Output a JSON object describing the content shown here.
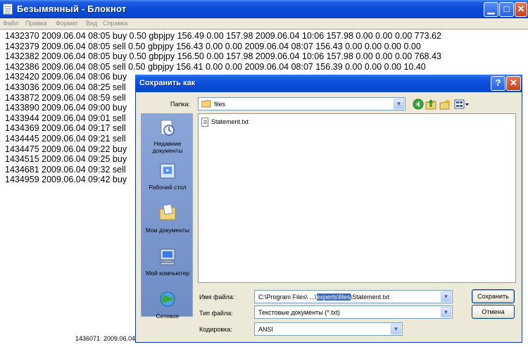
{
  "notepad": {
    "title": "Безымянный - Блокнот",
    "menu": [
      "Файл",
      "Правка",
      "Формат",
      "Вид",
      "Справка"
    ],
    "lines": [
      "1432370 2009.06.04 08:05 buy 0.50 gbpjpy 156.49 0.00 157.98 2009.06.04 10:06 157.98 0.00 0.00 0.00 773.62",
      "1432379 2009.06.04 08:05 sell 0.50 gbpjpy 156.43 0.00 0.00 2009.06.04 08:07 156.43 0.00 0.00 0.00 0.00",
      "1432382 2009.06.04 08:05 buy 0.50 gbpjpy 156.50 0.00 157.98 2009.06.04 10:06 157.98 0.00 0.00 0.00 768.43",
      "1432386 2009.06.04 08:05 sell 0.50 gbpjpy 156.41 0.00 0.00 2009.06.04 08:07 156.39 0.00 0.00 0.00 10.40",
      "1432420 2009.06.04 08:06 buy",
      "1433036 2009.06.04 08:25 sell",
      "1433872 2009.06.04 08:59 sell",
      "1433890 2009.06.04 09:00 buy",
      "1433944 2009.06.04 09:01 sell",
      "1434369 2009.06.04 09:17 sell",
      "1434445 2009.06.04 09:21 sell",
      "1434475 2009.06.04 09:22 buy",
      "1434515 2009.06.04 09:25 buy",
      "1434681 2009.06.04 09:32 sell",
      "1434959 2009.06.04 09:42 buy"
    ],
    "status_fragment": "1436071  2009.06.04"
  },
  "dialog": {
    "title": "Сохранить как",
    "folder_label": "Папка:",
    "folder_value": "files",
    "places": [
      {
        "icon": "recent-documents-icon",
        "label": "Недавние документы"
      },
      {
        "icon": "desktop-icon",
        "label": "Рабочий стол"
      },
      {
        "icon": "my-documents-icon",
        "label": "Мои документы"
      },
      {
        "icon": "my-computer-icon",
        "label": "Мой компьютер"
      },
      {
        "icon": "network-icon",
        "label": "Сетевое"
      }
    ],
    "files": [
      "Statement.txt"
    ],
    "filename_label": "Имя файла:",
    "filename_prefix": "C:\\Program Files\\ ...\\",
    "filename_selected": "experts\\files",
    "filename_suffix": "\\Statement.txt",
    "filetype_label": "Тип файла:",
    "filetype_value": "Текстовые документы (*.txt)",
    "encoding_label": "Кодировка:",
    "encoding_value": "ANSI",
    "save_label": "Сохранить",
    "cancel_label": "Отмена",
    "help_glyph": "?",
    "close_glyph": "✕"
  },
  "toolbar_icons": [
    "back-icon",
    "up-folder-icon",
    "new-folder-icon",
    "view-menu-icon"
  ],
  "colors": {
    "title_blue": "#0a4bd8",
    "selection": "#316ac5",
    "dialog_bg": "#ece9d8"
  }
}
